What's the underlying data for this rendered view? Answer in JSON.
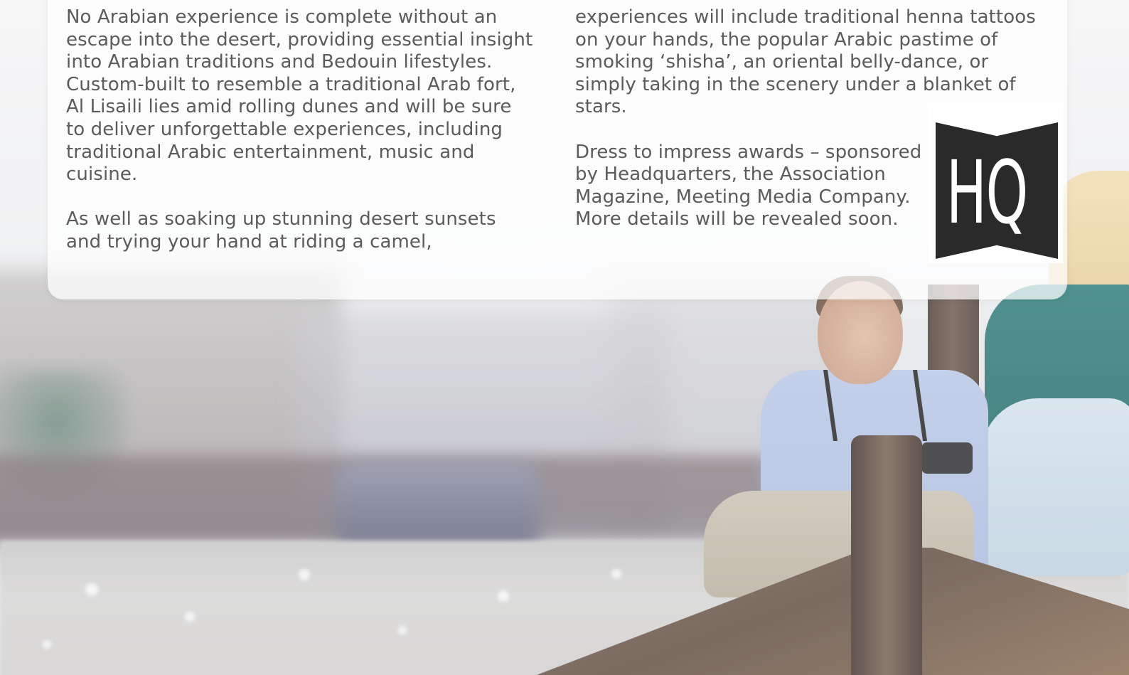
{
  "article": {
    "left_column": {
      "p1": "No Arabian experience is complete without an\nescape into the desert, providing essential insight\ninto Arabian traditions and Bedouin lifestyles.\nCustom-built to resemble a traditional Arab fort,\nAl Lisaili lies amid rolling dunes and will be sure\nto deliver unforgettable experiences, including\ntraditional Arabic entertainment, music and\ncuisine.",
      "p2": "As well as soaking up stunning desert sunsets\nand trying your hand at riding a camel,"
    },
    "right_column": {
      "p1": "experiences will include traditional henna tattoos\non your hands, the popular Arabic pastime of\nsmoking ‘shisha’, an oriental belly-dance, or\nsimply taking in the scenery under a blanket of\nstars.",
      "p2": "Dress to impress awards – sponsored\nby Headquarters, the Association\nMagazine, Meeting Media Company.\nMore details will be revealed soon."
    }
  },
  "logo": {
    "text": "HQ"
  },
  "colors": {
    "text": "#5b5b5b",
    "logo_bg": "#2a2a2a"
  }
}
